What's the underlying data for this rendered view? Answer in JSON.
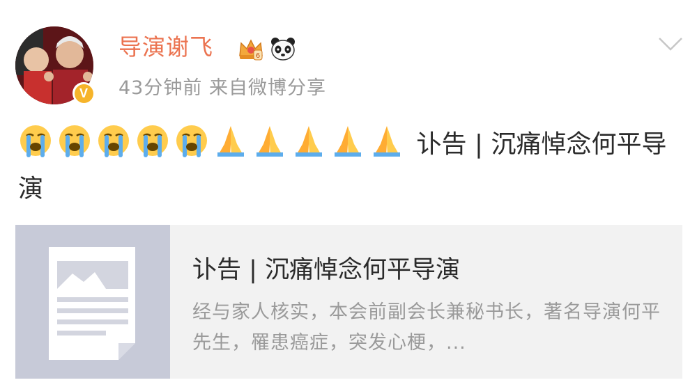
{
  "post": {
    "username": "导演谢飞",
    "meta": "43分钟前 来自微博分享",
    "verified_mark": "V",
    "emojis_crying_count": 5,
    "emojis_pray_count": 5,
    "body_text": "讣告 | 沉痛悼念何平导演"
  },
  "card": {
    "title": "讣告 | 沉痛悼念何平导演",
    "description": "经与家人核实，本会前副会长兼秘书长，著名导演何平先生，罹患癌症，突发心梗，..."
  },
  "colors": {
    "username": "#eb7350",
    "meta": "#9a9a9a",
    "card_bg": "#f2f2f2",
    "thumb_bg": "#c7cad8",
    "verified": "#f6b42a"
  },
  "icons": {
    "crown": "crown-icon",
    "panda": "panda-icon",
    "chevron": "chevron-down-icon",
    "crying": "crying-face-icon",
    "pray": "folded-hands-icon",
    "document": "article-placeholder-icon"
  }
}
